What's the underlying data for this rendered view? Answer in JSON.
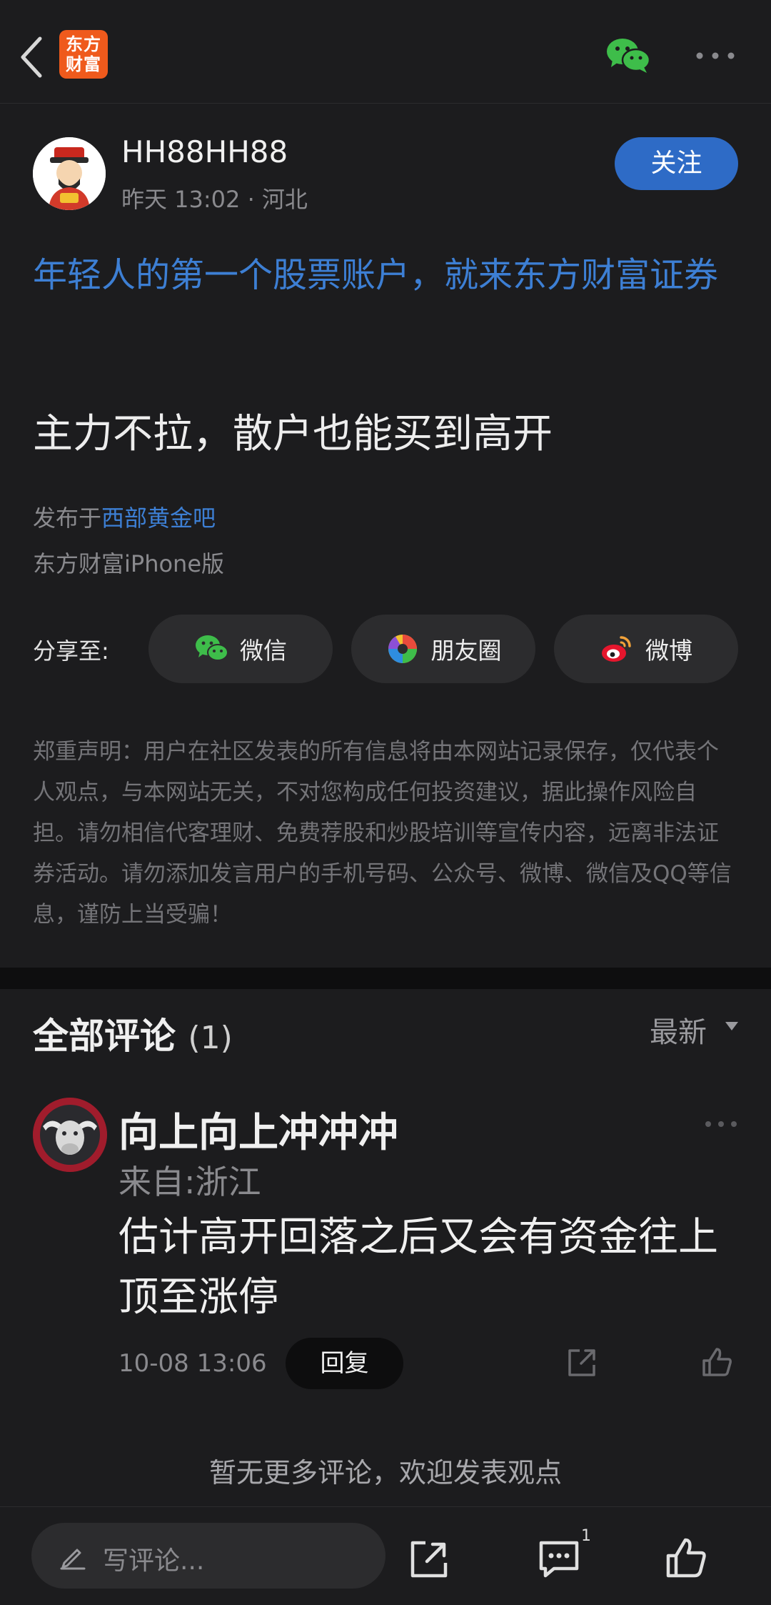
{
  "header": {
    "logo_line1": "东方",
    "logo_line2": "财富"
  },
  "author": {
    "name": "HH88HH88",
    "meta": "昨天 13:02 · 河北",
    "follow_label": "关注"
  },
  "post": {
    "ad_text": "年轻人的第一个股票账户，就来东方财富证券",
    "title": "主力不拉，散户也能买到高开",
    "published_prefix": "发布于",
    "bar_name": "西部黄金吧",
    "client": "东方财富iPhone版"
  },
  "share": {
    "label": "分享至:",
    "wechat": "微信",
    "moments": "朋友圈",
    "weibo": "微博"
  },
  "disclaimer": "郑重声明：用户在社区发表的所有信息将由本网站记录保存，仅代表个人观点，与本网站无关，不对您构成任何投资建议，据此操作风险自担。请勿相信代客理财、免费荐股和炒股培训等宣传内容，远离非法证券活动。请勿添加发言用户的手机号码、公众号、微博、微信及QQ等信息，谨防上当受骗！",
  "comments": {
    "title": "全部评论",
    "count": "(1)",
    "sort_label": "最新",
    "items": [
      {
        "user": "向上向上冲冲冲",
        "location": "来自:浙江",
        "text": "估计高开回落之后又会有资金往上顶至涨停",
        "time": "10-08 13:06",
        "reply_label": "回复"
      }
    ],
    "no_more": "暂无更多评论，欢迎发表观点"
  },
  "bottom_bar": {
    "input_placeholder": "写评论...",
    "comment_count": "1"
  },
  "colors": {
    "background": "#1c1c1e",
    "accent_blue": "#2e6bc6",
    "link_blue": "#3d7fd4",
    "wechat_green": "#3ebd4a",
    "brand_orange": "#ef5a1c"
  }
}
